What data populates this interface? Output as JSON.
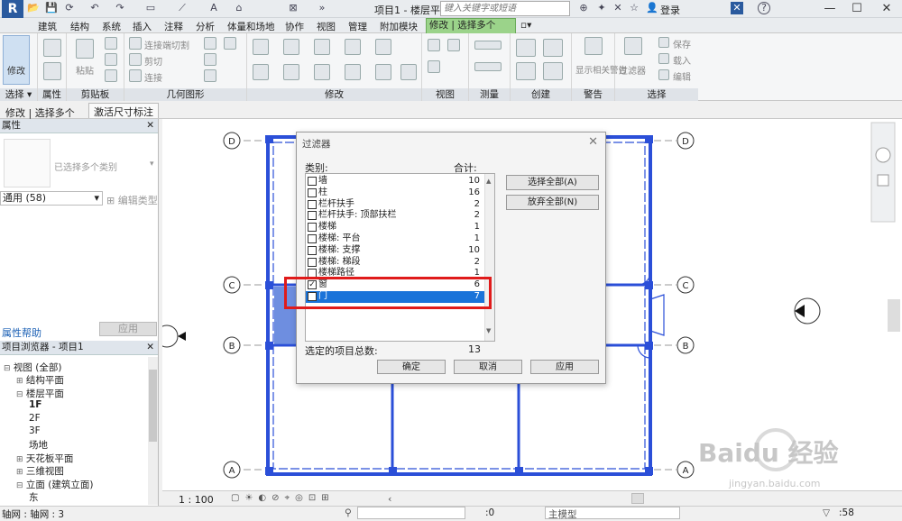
{
  "titlebar": {
    "app_logo": "R",
    "document_title": "项目1 - 楼层平...",
    "search_placeholder": "键入关键字或短语",
    "login": "登录",
    "help": "?"
  },
  "tabs": [
    "建筑",
    "结构",
    "系统",
    "插入",
    "注释",
    "分析",
    "体量和场地",
    "协作",
    "视图",
    "管理",
    "附加模块"
  ],
  "active_tab": "修改 | 选择多个",
  "ribbon": {
    "select_label": "选择",
    "panels": {
      "properties": "属性",
      "clipboard": "剪贴板",
      "geometry": "几何图形",
      "modify": "修改",
      "view": "视图",
      "measure": "测量",
      "create": "创建",
      "warning": "警告",
      "select": "选择"
    },
    "modify_button": "修改",
    "paste": "粘贴",
    "join_cut": "连接端切割",
    "cut": "剪切",
    "join": "连接",
    "show_related_warnings": "显示相关警告",
    "filter": "过滤器",
    "save": "保存",
    "load": "载入",
    "edit": "编辑"
  },
  "context_bar": {
    "mode": "修改 | 选择多个",
    "activate_dims": "激活尺寸标注"
  },
  "properties": {
    "title": "属性",
    "type_selector": "已选择多个类别",
    "filter_value": "通用 (58)",
    "edit_type": "编辑类型",
    "help_link": "属性帮助",
    "apply": "应用"
  },
  "project_browser": {
    "title": "项目浏览器 - 项目1",
    "items": [
      {
        "label": "视图 (全部)",
        "level": 0,
        "toggle": "⊟"
      },
      {
        "label": "结构平面",
        "level": 1,
        "toggle": "⊞"
      },
      {
        "label": "楼层平面",
        "level": 1,
        "toggle": "⊟"
      },
      {
        "label": "1F",
        "level": 2,
        "toggle": "",
        "bold": true
      },
      {
        "label": "2F",
        "level": 2,
        "toggle": ""
      },
      {
        "label": "3F",
        "level": 2,
        "toggle": ""
      },
      {
        "label": "场地",
        "level": 2,
        "toggle": ""
      },
      {
        "label": "天花板平面",
        "level": 1,
        "toggle": "⊞"
      },
      {
        "label": "三维视图",
        "level": 1,
        "toggle": "⊞"
      },
      {
        "label": "立面 (建筑立面)",
        "level": 1,
        "toggle": "⊟"
      },
      {
        "label": "东",
        "level": 2,
        "toggle": ""
      }
    ]
  },
  "grid_labels": {
    "d": "D",
    "c": "C",
    "b": "B",
    "a": "A"
  },
  "filter_dialog": {
    "title": "过滤器",
    "category_header": "类别:",
    "count_header": "合计:",
    "rows": [
      {
        "name": "墙",
        "count": "10",
        "checked": false
      },
      {
        "name": "柱",
        "count": "16",
        "checked": false
      },
      {
        "name": "栏杆扶手",
        "count": "2",
        "checked": false
      },
      {
        "name": "栏杆扶手: 顶部扶栏",
        "count": "2",
        "checked": false
      },
      {
        "name": "楼梯",
        "count": "1",
        "checked": false
      },
      {
        "name": "楼梯: 平台",
        "count": "1",
        "checked": false
      },
      {
        "name": "楼梯: 支撑",
        "count": "10",
        "checked": false
      },
      {
        "name": "楼梯: 梯段",
        "count": "2",
        "checked": false
      },
      {
        "name": "楼梯路径",
        "count": "1",
        "checked": false
      },
      {
        "name": "窗",
        "count": "6",
        "checked": true
      },
      {
        "name": "门",
        "count": "7",
        "checked": true,
        "selected": true
      }
    ],
    "select_all": "选择全部(A)",
    "deselect_all": "放弃全部(N)",
    "total_label": "选定的项目总数:",
    "total_value": "13",
    "ok": "确定",
    "cancel": "取消",
    "apply": "应用"
  },
  "view_bar": {
    "scale": "1 : 100"
  },
  "status_bar": {
    "left": "轴网 : 轴网 : 3",
    "worksets": ":0",
    "model": "主模型",
    "right": ":58"
  },
  "watermark": {
    "brand": "Baidu 经验",
    "url": "jingyan.baidu.com"
  },
  "colors": {
    "accent_tab": "#9bd38a",
    "selection": "#1a73d9",
    "highlight": "#e01b1b",
    "wall": "#2b4fd8"
  }
}
